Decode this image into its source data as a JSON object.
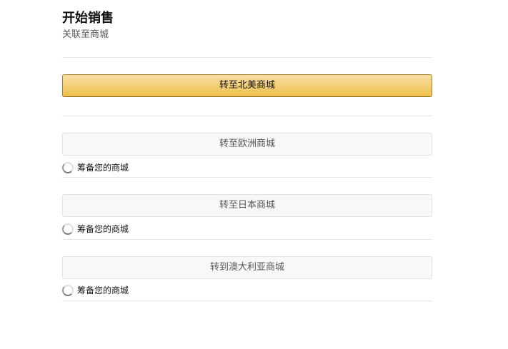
{
  "header": {
    "title": "开始销售",
    "subtitle": "关联至商城"
  },
  "primary_button": "转至北美商城",
  "marketplaces": [
    {
      "button": "转至欧洲商城",
      "status": "筹备您的商城"
    },
    {
      "button": "转至日本商城",
      "status": "筹备您的商城"
    },
    {
      "button": "转到澳大利亚商城",
      "status": "筹备您的商城"
    }
  ]
}
